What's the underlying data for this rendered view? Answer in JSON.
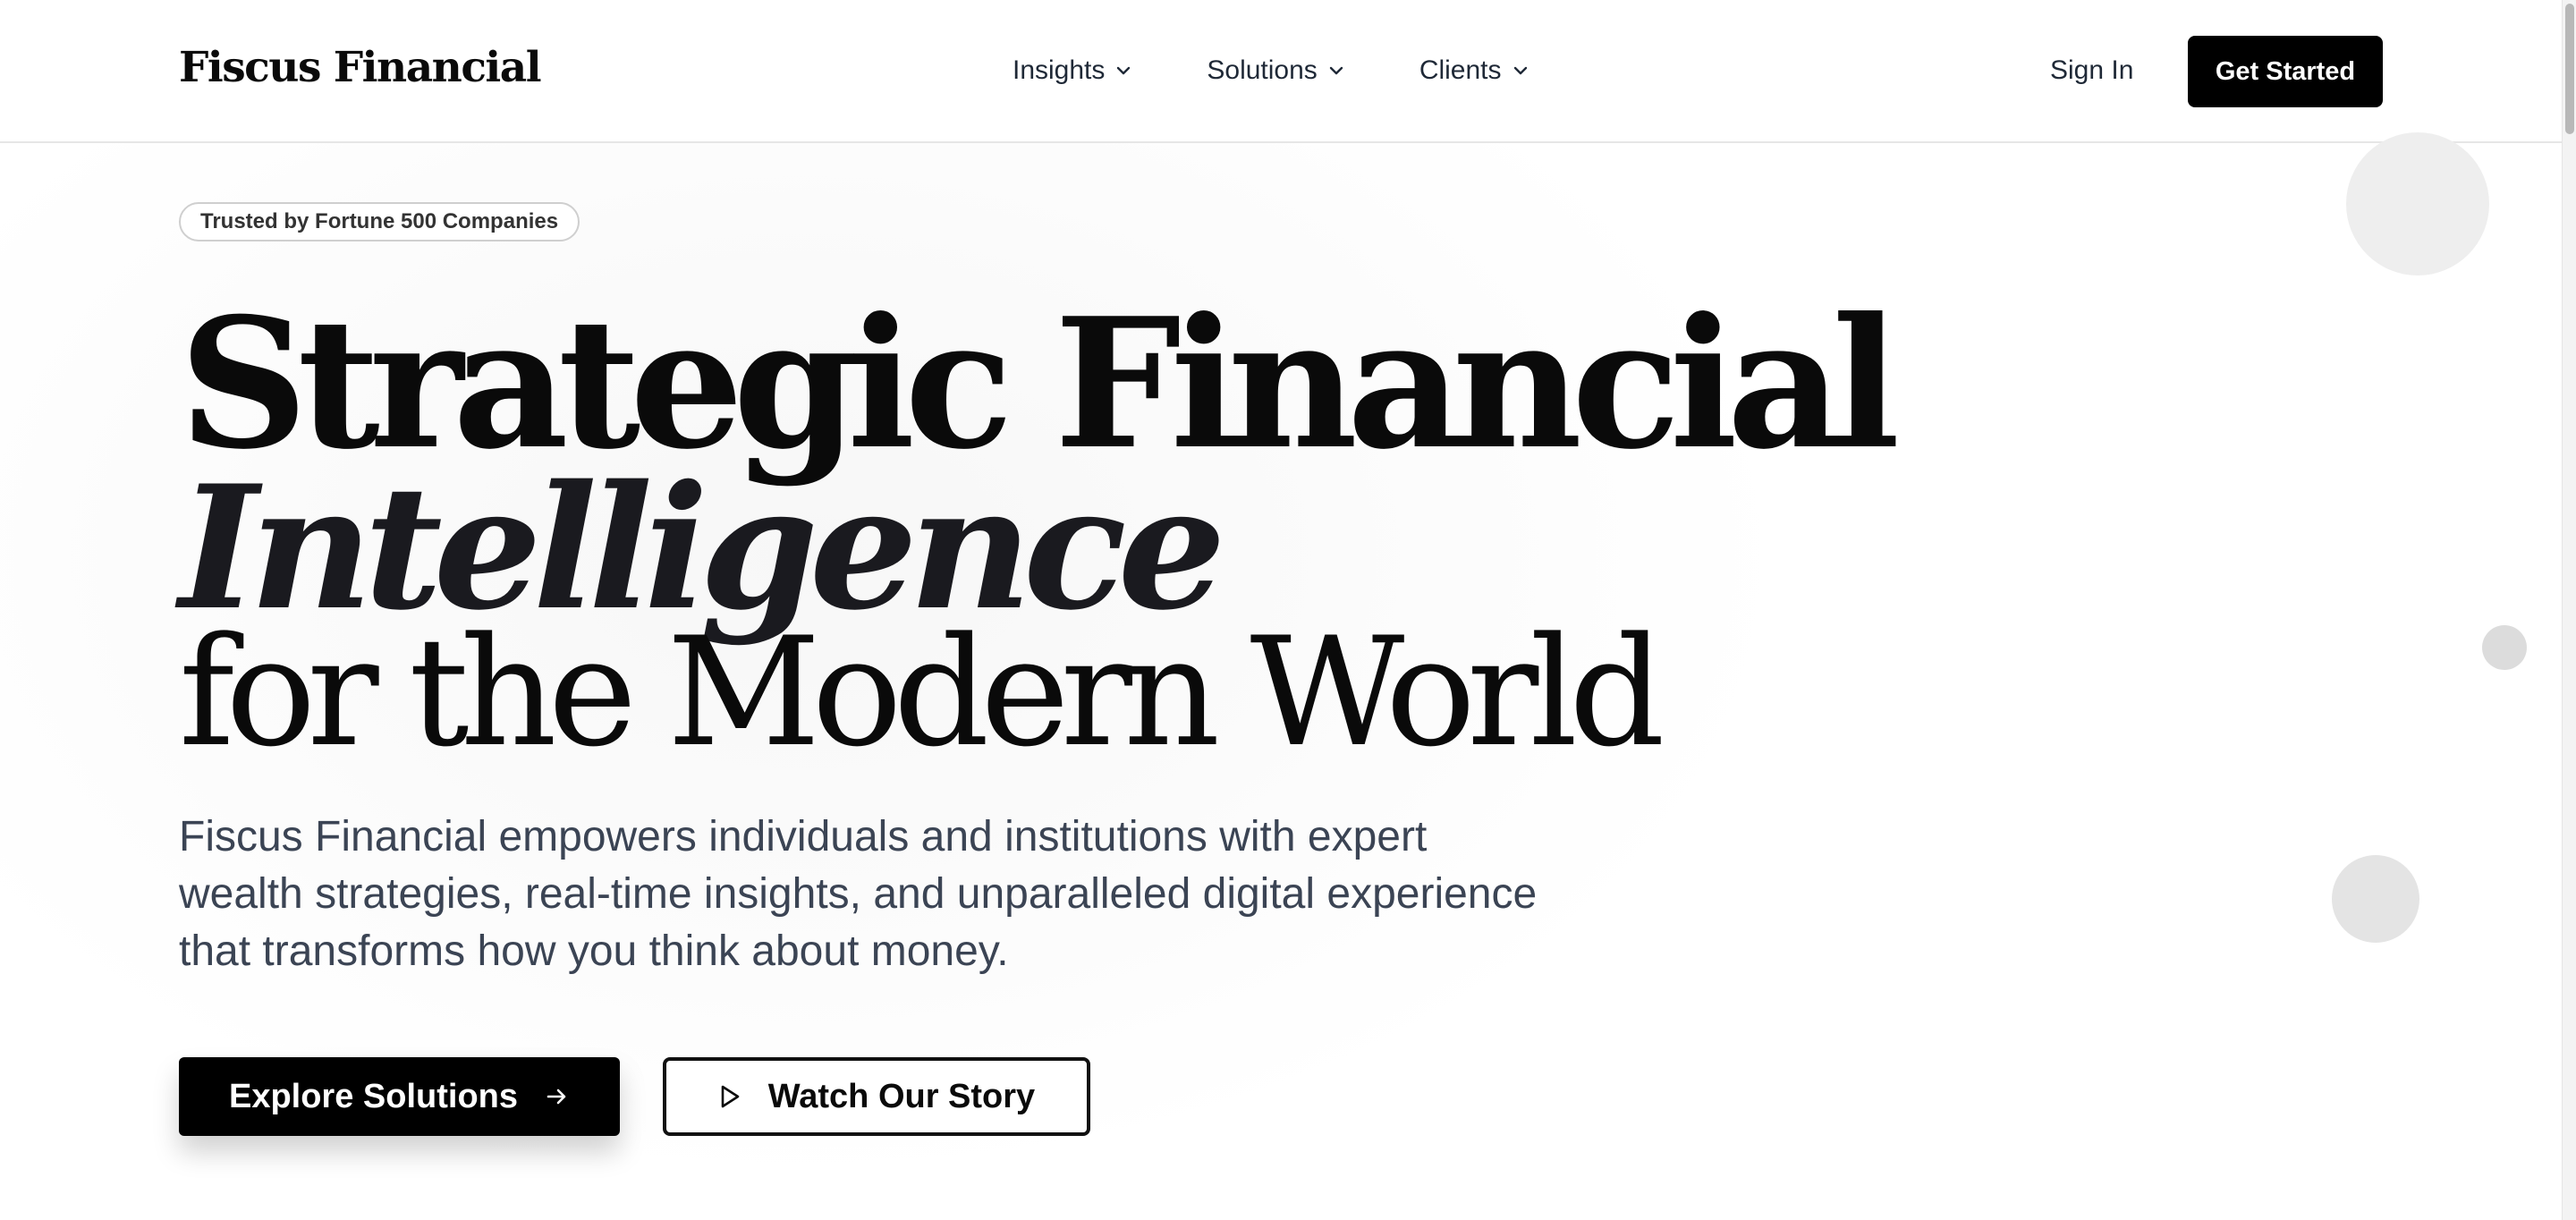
{
  "header": {
    "logo": "Fiscus Financial",
    "nav": [
      {
        "label": "Insights"
      },
      {
        "label": "Solutions"
      },
      {
        "label": "Clients"
      }
    ],
    "sign_in": "Sign In",
    "cta": "Get Started"
  },
  "hero": {
    "badge": "Trusted by Fortune 500 Companies",
    "title_line1": "Strategic Financial",
    "title_line2": "Intelligence",
    "title_line3": "for the Modern World",
    "subtitle": "Fiscus Financial empowers individuals and institutions with expert wealth strategies, real-time insights, and unparalleled digital experience that transforms how you think about money.",
    "primary_button": "Explore Solutions",
    "secondary_button": "Watch Our Story"
  },
  "icons": {
    "nav_chevron": "chevron-down-icon",
    "primary_arrow": "arrow-right-icon",
    "secondary_play": "play-icon"
  },
  "colors": {
    "brand": "#000000",
    "text_primary": "#0a0a0a",
    "text_secondary": "#3b4454",
    "decorative_circles": "#e8e8e8"
  }
}
